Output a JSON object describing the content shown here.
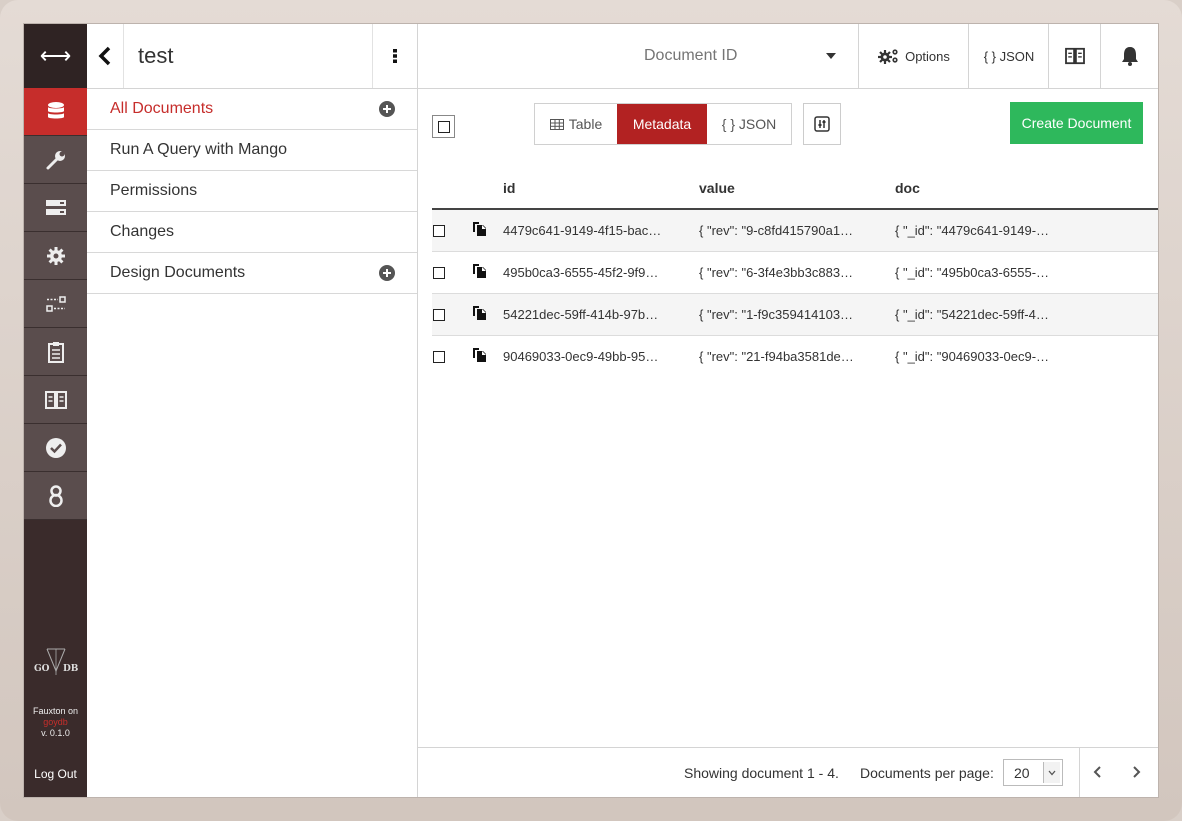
{
  "sidebar": {
    "title": "test",
    "items": [
      {
        "label": "All Documents",
        "active": true,
        "has_add": true
      },
      {
        "label": "Run A Query with Mango",
        "active": false,
        "has_add": false
      },
      {
        "label": "Permissions",
        "active": false,
        "has_add": false
      },
      {
        "label": "Changes",
        "active": false,
        "has_add": false
      },
      {
        "label": "Design Documents",
        "active": false,
        "has_add": true
      }
    ]
  },
  "leftnav": {
    "items": [
      "database-icon",
      "wrench-icon",
      "server-icon",
      "gear-icon",
      "replication-icon",
      "clipboard-icon",
      "book-icon",
      "check-icon",
      "user-icon"
    ],
    "logo": "GO  DB",
    "version_prefix": "Fauxton on",
    "brand": "goydb",
    "version": "v. 0.1.0",
    "logout": "Log Out"
  },
  "topbar": {
    "docid_placeholder": "Document ID",
    "options_label": "Options",
    "json_label": "{ } JSON"
  },
  "toolbar": {
    "views": [
      "Table",
      "Metadata",
      "{ } JSON"
    ],
    "active_view": "Metadata",
    "create_label": "Create Document"
  },
  "table": {
    "headers": [
      "id",
      "value",
      "doc"
    ],
    "rows": [
      {
        "id": "4479c641-9149-4f15-bac…",
        "value": "{ \"rev\": \"9-c8fd415790a1…",
        "doc": "{ \"_id\": \"4479c641-9149-…"
      },
      {
        "id": "495b0ca3-6555-45f2-9f9…",
        "value": "{ \"rev\": \"6-3f4e3bb3c883…",
        "doc": "{ \"_id\": \"495b0ca3-6555-…"
      },
      {
        "id": "54221dec-59ff-414b-97b…",
        "value": "{ \"rev\": \"1-f9c359414103…",
        "doc": "{ \"_id\": \"54221dec-59ff-4…"
      },
      {
        "id": "90469033-0ec9-49bb-95…",
        "value": "{ \"rev\": \"21-f94ba3581de…",
        "doc": "{ \"_id\": \"90469033-0ec9-…"
      }
    ]
  },
  "footer": {
    "showing": "Showing document 1 - 4.",
    "per_page_label": "Documents per page:",
    "per_page": "20"
  },
  "colors": {
    "accent": "#c62d2b",
    "create": "#2eb85c",
    "nav_bg": "#3a2b2b"
  }
}
